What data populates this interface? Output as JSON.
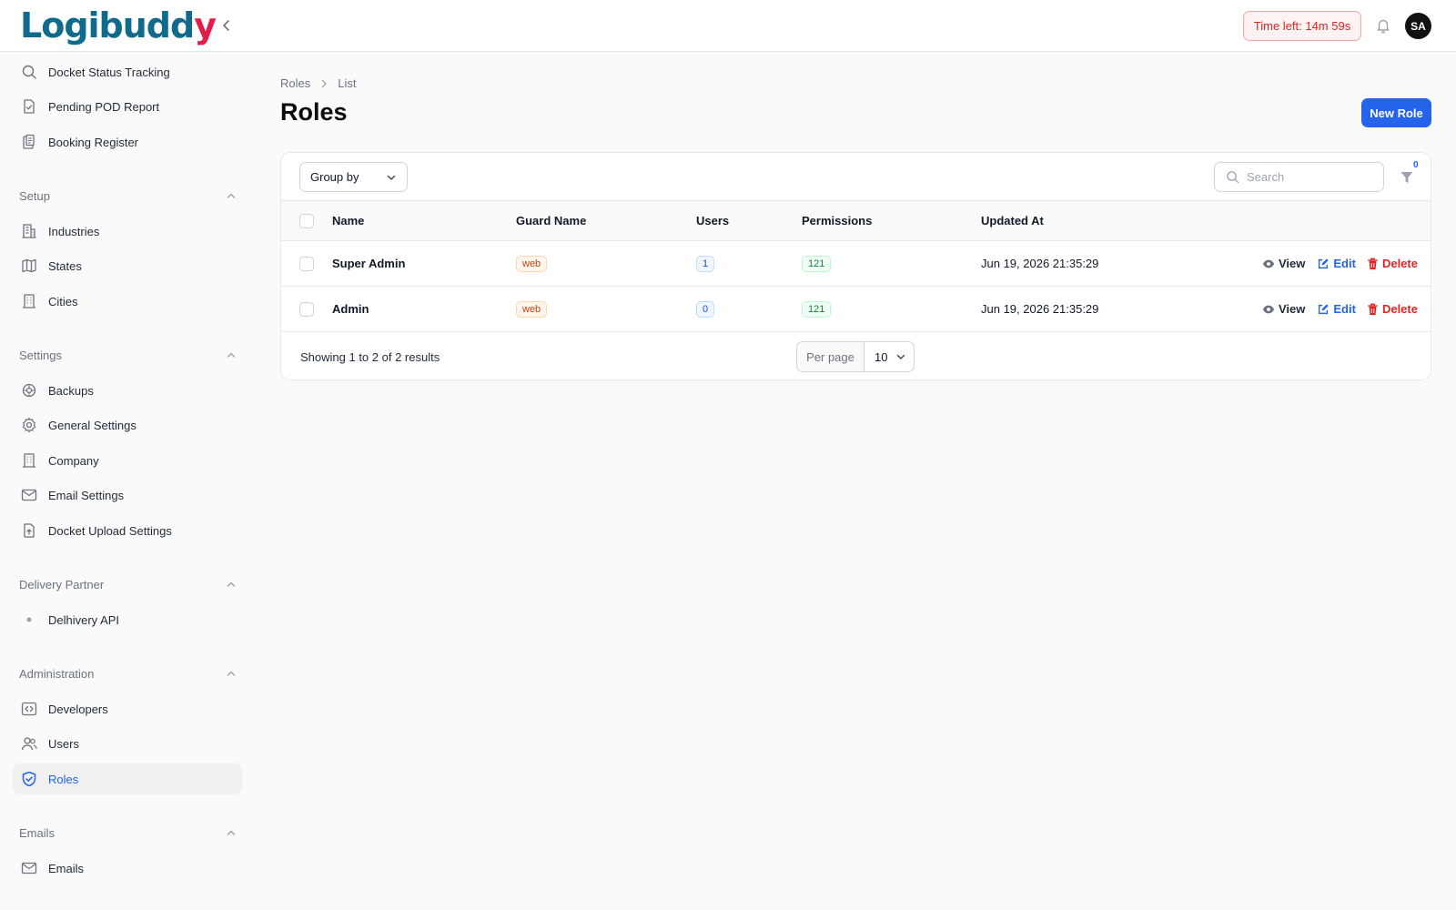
{
  "header": {
    "logo_main": "Logibudd",
    "logo_end": "y",
    "timer": "Time left: 14m 59s",
    "avatar": "SA"
  },
  "sidebar": {
    "top_items": [
      {
        "label": "Docket Status Tracking",
        "icon": "search-icon"
      },
      {
        "label": "Pending POD Report",
        "icon": "document-check-icon"
      },
      {
        "label": "Booking Register",
        "icon": "clipboard-icon"
      }
    ],
    "groups": [
      {
        "label": "Setup",
        "items": [
          {
            "label": "Industries",
            "icon": "building-icon"
          },
          {
            "label": "States",
            "icon": "map-icon"
          },
          {
            "label": "Cities",
            "icon": "office-building-icon"
          }
        ]
      },
      {
        "label": "Settings",
        "items": [
          {
            "label": "Backups",
            "icon": "backup-icon"
          },
          {
            "label": "General Settings",
            "icon": "gear-icon"
          },
          {
            "label": "Company",
            "icon": "office-building-icon"
          },
          {
            "label": "Email Settings",
            "icon": "envelope-icon"
          },
          {
            "label": "Docket Upload Settings",
            "icon": "document-upload-icon"
          }
        ]
      },
      {
        "label": "Delivery Partner",
        "items": [
          {
            "label": "Delhivery API",
            "icon": "dot-icon"
          }
        ]
      },
      {
        "label": "Administration",
        "items": [
          {
            "label": "Developers",
            "icon": "code-icon"
          },
          {
            "label": "Users",
            "icon": "users-icon"
          },
          {
            "label": "Roles",
            "icon": "shield-check-icon",
            "active": true
          }
        ]
      },
      {
        "label": "Emails",
        "items": [
          {
            "label": "Emails",
            "icon": "envelope-icon"
          }
        ]
      }
    ]
  },
  "main": {
    "breadcrumb": [
      "Roles",
      "List"
    ],
    "title": "Roles",
    "new_button": "New Role",
    "toolbar": {
      "group_by": "Group by",
      "search_placeholder": "Search",
      "filter_count": "0"
    },
    "table": {
      "columns": [
        "Name",
        "Guard Name",
        "Users",
        "Permissions",
        "Updated At"
      ],
      "rows": [
        {
          "name": "Super Admin",
          "guard": "web",
          "users": "1",
          "permissions": "121",
          "updated_at": "Jun 19, 2026 21:35:29"
        },
        {
          "name": "Admin",
          "guard": "web",
          "users": "0",
          "permissions": "121",
          "updated_at": "Jun 19, 2026 21:35:29"
        }
      ],
      "actions": {
        "view": "View",
        "edit": "Edit",
        "delete": "Delete"
      }
    },
    "footer": {
      "showing": "Showing 1 to 2 of 2 results",
      "per_page_label": "Per page",
      "per_page_value": "10"
    }
  },
  "colors": {
    "accent": "#2563eb",
    "brand": "#0f6a8c",
    "danger": "#dc2626"
  }
}
